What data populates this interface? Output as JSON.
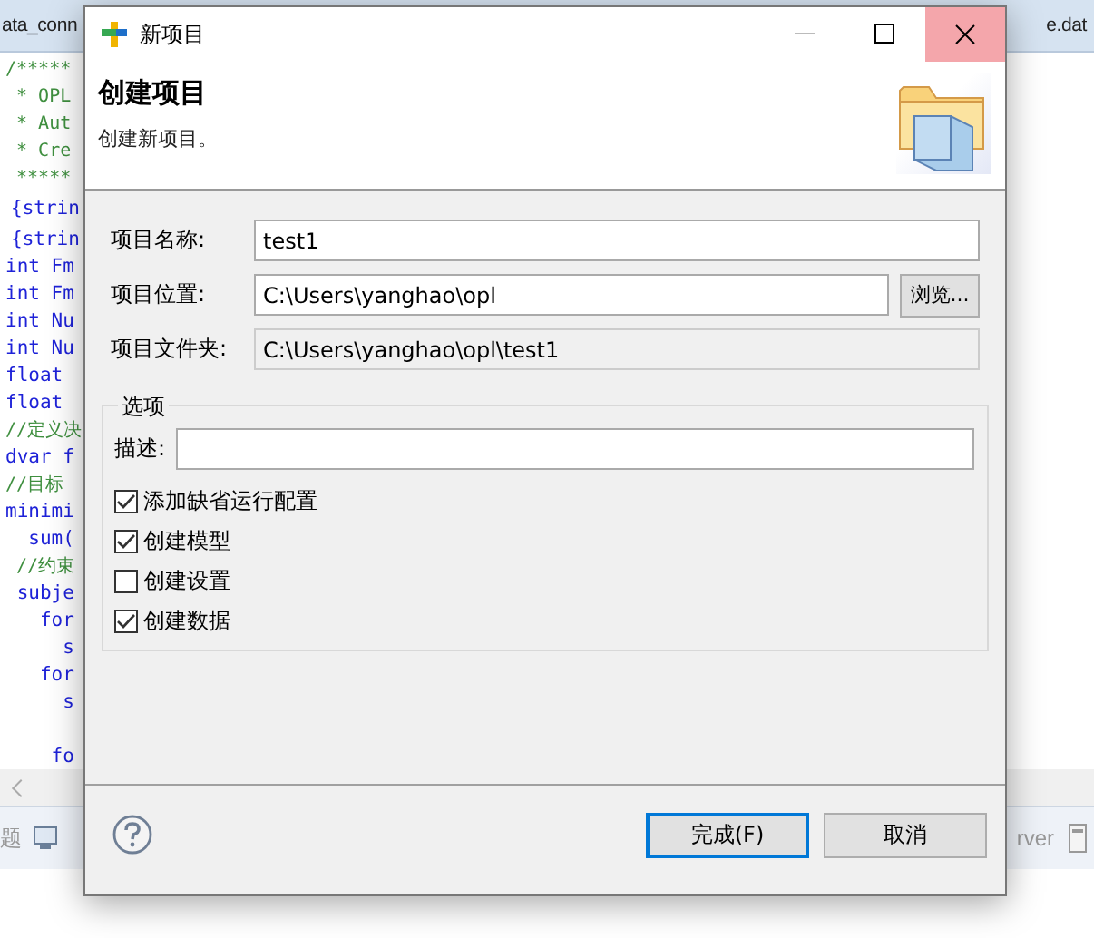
{
  "background": {
    "editor_tab": "ata_conn",
    "right_tab": "e.dat",
    "code_lines": [
      {
        "text": "/*****",
        "kind": "comment"
      },
      {
        "text": " * OPL",
        "kind": "comment"
      },
      {
        "text": " * Aut",
        "kind": "comment"
      },
      {
        "text": " * Cre",
        "kind": "comment"
      },
      {
        "text": " *****",
        "kind": "comment"
      },
      {
        "text": "{strin",
        "kind": "code"
      },
      {
        "text": "{strin",
        "kind": "code"
      },
      {
        "text": "int Fm",
        "kind": "keyword"
      },
      {
        "text": "int Fm",
        "kind": "keyword"
      },
      {
        "text": "int Nu",
        "kind": "keyword"
      },
      {
        "text": "int Nu",
        "kind": "keyword"
      },
      {
        "text": "float",
        "kind": "keyword"
      },
      {
        "text": "float",
        "kind": "keyword"
      },
      {
        "text": "//定义决",
        "kind": "comment"
      },
      {
        "text": "dvar f",
        "kind": "keyword"
      },
      {
        "text": "//目标",
        "kind": "comment"
      },
      {
        "text": "minimi",
        "kind": "keyword"
      },
      {
        "text": "  sum(",
        "kind": "keyword"
      },
      {
        "text": " //约束",
        "kind": "comment"
      },
      {
        "text": " subje",
        "kind": "keyword"
      },
      {
        "text": "   for",
        "kind": "keyword"
      },
      {
        "text": "     s",
        "kind": "keyword"
      },
      {
        "text": "   for",
        "kind": "keyword"
      },
      {
        "text": "     s",
        "kind": "keyword"
      },
      {
        "kind": "blank"
      },
      {
        "text": "    fo",
        "kind": "keyword"
      }
    ],
    "panel_tab": "题",
    "right_panel_text": "rver"
  },
  "dialog": {
    "title": "新项目",
    "heading": "创建项目",
    "subtitle": "创建新项目。",
    "fields": [
      {
        "label": "项目名称:",
        "value": "test1",
        "disabled": false
      },
      {
        "label": "项目位置:",
        "value": "C:\\Users\\yanghao\\opl",
        "disabled": false,
        "browse": "浏览..."
      },
      {
        "label": "项目文件夹:",
        "value": "C:\\Users\\yanghao\\opl\\test1",
        "disabled": true
      }
    ],
    "options": {
      "title": "选项",
      "description_label": "描述:",
      "checkboxes": [
        {
          "label": "添加缺省运行配置",
          "checked": true
        },
        {
          "label": "创建模型",
          "checked": true
        },
        {
          "label": "创建设置",
          "checked": false
        },
        {
          "label": "创建数据",
          "checked": true
        }
      ]
    },
    "buttons": [
      {
        "label": "完成(F)",
        "default": true
      },
      {
        "label": "取消",
        "default": false
      }
    ]
  }
}
